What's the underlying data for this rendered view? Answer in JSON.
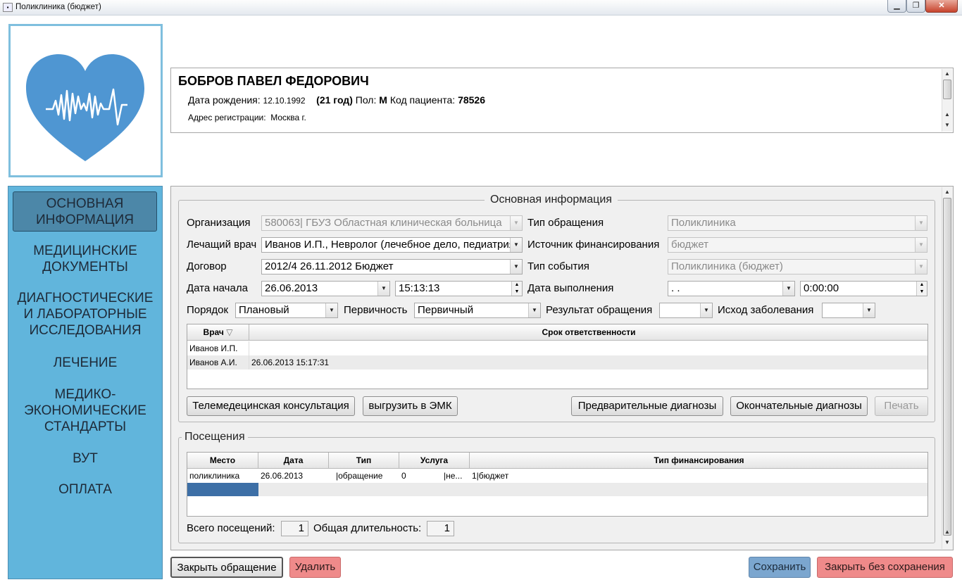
{
  "window": {
    "title": "Поликлиника (бюджет)",
    "icon": "app-icon",
    "controls": {
      "minimize": "▁",
      "maximize": "❐",
      "close": "✕"
    }
  },
  "patient": {
    "name": "БОБРОВ ПАВЕЛ ФЕДОРОВИЧ",
    "dob_label": "Дата рождения:",
    "dob": "12.10.1992",
    "age": "(21 год)",
    "sex_label": "Пол:",
    "sex": "М",
    "code_label": "Код пациента:",
    "code": "78526",
    "addr_label": "Адрес регистрации:",
    "addr": "Москва г."
  },
  "nav": [
    {
      "label": "ОСНОВНАЯ ИНФОРМАЦИЯ",
      "active": true
    },
    {
      "label": "МЕДИЦИНСКИЕ ДОКУМЕНТЫ"
    },
    {
      "label": "ДИАГНОСТИЧЕСКИЕ И ЛАБОРАТОРНЫЕ ИССЛЕДОВАНИЯ"
    },
    {
      "label": "ЛЕЧЕНИЕ"
    },
    {
      "label": "МЕДИКО-ЭКОНОМИЧЕСКИЕ СТАНДАРТЫ"
    },
    {
      "label": "ВУТ"
    },
    {
      "label": "ОПЛАТА"
    }
  ],
  "main": {
    "section_title": "Основная информация",
    "org_label": "Организация",
    "org": "580063| ГБУЗ Областная клиническая больница",
    "doctor_label": "Лечащий врач",
    "doctor": "Иванов И.П., Невролог (лечебное дело, педиатрия)",
    "contract_label": "Договор",
    "contract": "2012/4 26.11.2012 Бюджет",
    "start_label": "Дата начала",
    "start_date": "26.06.2013",
    "start_time": "15:13:13",
    "visit_type_label": "Тип обращения",
    "visit_type": "Поликлиника",
    "fin_label": "Источник финансирования",
    "fin": "бюджет",
    "event_label": "Тип события",
    "event": "Поликлиника (бюджет)",
    "done_label": "Дата выполнения",
    "done_date": "  .  .",
    "done_time": "0:00:00",
    "order_label": "Порядок",
    "order": "Плановый",
    "primary_label": "Первичность",
    "primary": "Первичный",
    "result_label": "Результат обращения",
    "result": "",
    "outcome_label": "Исход заболевания",
    "outcome": "",
    "resp_table": {
      "headers": [
        "Врач",
        "Срок ответственности"
      ],
      "rows": [
        [
          "Иванов И.П.",
          ""
        ],
        [
          "Иванов А.И.",
          "26.06.2013 15:17:31"
        ]
      ]
    },
    "buttons": {
      "telemed": "Телемедецинская консультация",
      "export": "выгрузить в ЭМК",
      "prelim": "Предварительные диагнозы",
      "final": "Окончательные диагнозы",
      "print": "Печать"
    }
  },
  "visits": {
    "title": "Посещения",
    "headers": [
      "Место",
      "Дата",
      "Тип",
      "Услуга",
      "Тип финансирования"
    ],
    "rows": [
      [
        "поликлиника",
        "26.06.2013",
        "|обращение",
        "0",
        "|не...",
        "1|бюджет"
      ]
    ],
    "total_label": "Всего посещений:",
    "total": "1",
    "dur_label": "Общая длительность:",
    "dur": "1"
  },
  "footer": {
    "close_visit": "Закрыть обращение",
    "delete": "Удалить",
    "save": "Сохранить",
    "close_nosave": "Закрыть без сохранения"
  },
  "colors": {
    "nav_bg": "#61b5dc",
    "nav_active": "#4c87a8",
    "heart": "#4f96d2",
    "save_btn": "#7ba6cf",
    "danger_btn": "#ef8a8a"
  }
}
